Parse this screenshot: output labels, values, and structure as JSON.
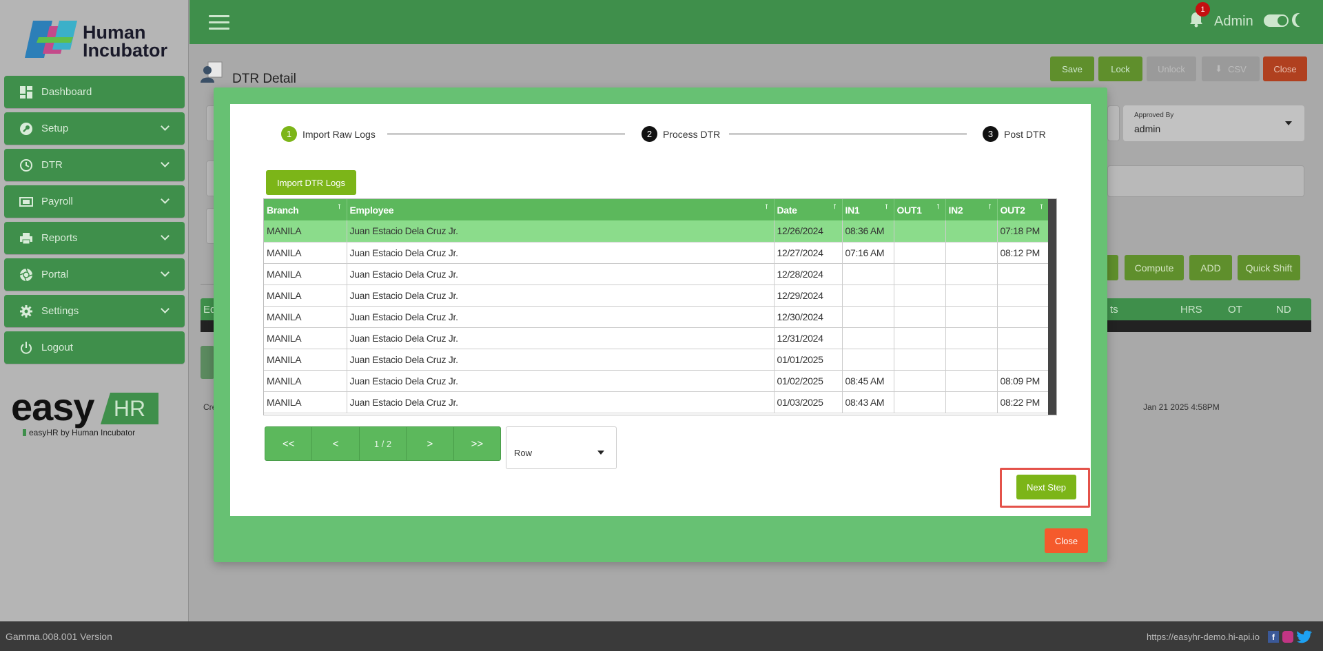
{
  "brand": {
    "name_line1": "Human",
    "name_line2": "Incubator",
    "easy": "easy",
    "hr": "HR",
    "byline": "easyHR by Human Incubator"
  },
  "sidebar": {
    "items": [
      {
        "label": "Dashboard",
        "icon": "dashboard-icon",
        "has_chevron": false
      },
      {
        "label": "Setup",
        "icon": "wrench-icon",
        "has_chevron": true
      },
      {
        "label": "DTR",
        "icon": "clock-icon",
        "has_chevron": true
      },
      {
        "label": "Payroll",
        "icon": "money-icon",
        "has_chevron": true
      },
      {
        "label": "Reports",
        "icon": "printer-icon",
        "has_chevron": true
      },
      {
        "label": "Portal",
        "icon": "aperture-icon",
        "has_chevron": true
      },
      {
        "label": "Settings",
        "icon": "gear-icon",
        "has_chevron": true
      },
      {
        "label": "Logout",
        "icon": "power-icon",
        "has_chevron": false
      }
    ]
  },
  "topbar": {
    "notification_count": "1",
    "user": "Admin"
  },
  "page": {
    "title": "DTR Detail",
    "toolbar": {
      "save": "Save",
      "lock": "Lock",
      "unlock": "Unlock",
      "csv": "CSV",
      "close": "Close"
    },
    "approved_by_label": "Approved By",
    "approved_by_value": "admin",
    "buttons": {
      "compute": "Compute",
      "add": "ADD",
      "quick_shift": "Quick Shift"
    },
    "bg_columns": {
      "ed": "Ed",
      "ts": "ts",
      "hrs": "HRS",
      "ot": "OT",
      "nd": "ND"
    },
    "bg_created_prefix": "Cre",
    "bg_date": "Jan 21 2025 4:58PM"
  },
  "modal": {
    "steps": [
      {
        "num": "1",
        "label": "Import Raw Logs",
        "state": "active"
      },
      {
        "num": "2",
        "label": "Process DTR",
        "state": "pending"
      },
      {
        "num": "3",
        "label": "Post DTR",
        "state": "pending"
      }
    ],
    "import_button": "Import DTR Logs",
    "columns": [
      "Branch",
      "Employee",
      "Date",
      "IN1",
      "OUT1",
      "IN2",
      "OUT2"
    ],
    "rows": [
      [
        "MANILA",
        "Juan Estacio Dela Cruz Jr.",
        "12/26/2024",
        "08:36 AM",
        "",
        "",
        "07:18 PM"
      ],
      [
        "MANILA",
        "Juan Estacio Dela Cruz Jr.",
        "12/27/2024",
        "07:16 AM",
        "",
        "",
        "08:12 PM"
      ],
      [
        "MANILA",
        "Juan Estacio Dela Cruz Jr.",
        "12/28/2024",
        "",
        "",
        "",
        ""
      ],
      [
        "MANILA",
        "Juan Estacio Dela Cruz Jr.",
        "12/29/2024",
        "",
        "",
        "",
        ""
      ],
      [
        "MANILA",
        "Juan Estacio Dela Cruz Jr.",
        "12/30/2024",
        "",
        "",
        "",
        ""
      ],
      [
        "MANILA",
        "Juan Estacio Dela Cruz Jr.",
        "12/31/2024",
        "",
        "",
        "",
        ""
      ],
      [
        "MANILA",
        "Juan Estacio Dela Cruz Jr.",
        "01/01/2025",
        "",
        "",
        "",
        ""
      ],
      [
        "MANILA",
        "Juan Estacio Dela Cruz Jr.",
        "01/02/2025",
        "08:45 AM",
        "",
        "",
        "08:09 PM"
      ],
      [
        "MANILA",
        "Juan Estacio Dela Cruz Jr.",
        "01/03/2025",
        "08:43 AM",
        "",
        "",
        "08:22 PM"
      ]
    ],
    "selected_row": 0,
    "pager": {
      "first": "<<",
      "prev": "<",
      "info": "1 / 2",
      "next": ">",
      "last": ">>"
    },
    "row_select": "Row",
    "next_step": "Next Step",
    "close": "Close"
  },
  "footer": {
    "version": "Gamma.008.001 Version",
    "url": "https://easyhr-demo.hi-api.io"
  },
  "colors": {
    "primary": "#3f8f4b",
    "modal": "#67c173",
    "accent": "#7cb518",
    "danger": "#f55a2c",
    "header": "#5cb85c",
    "selected": "#8bdc8b"
  }
}
